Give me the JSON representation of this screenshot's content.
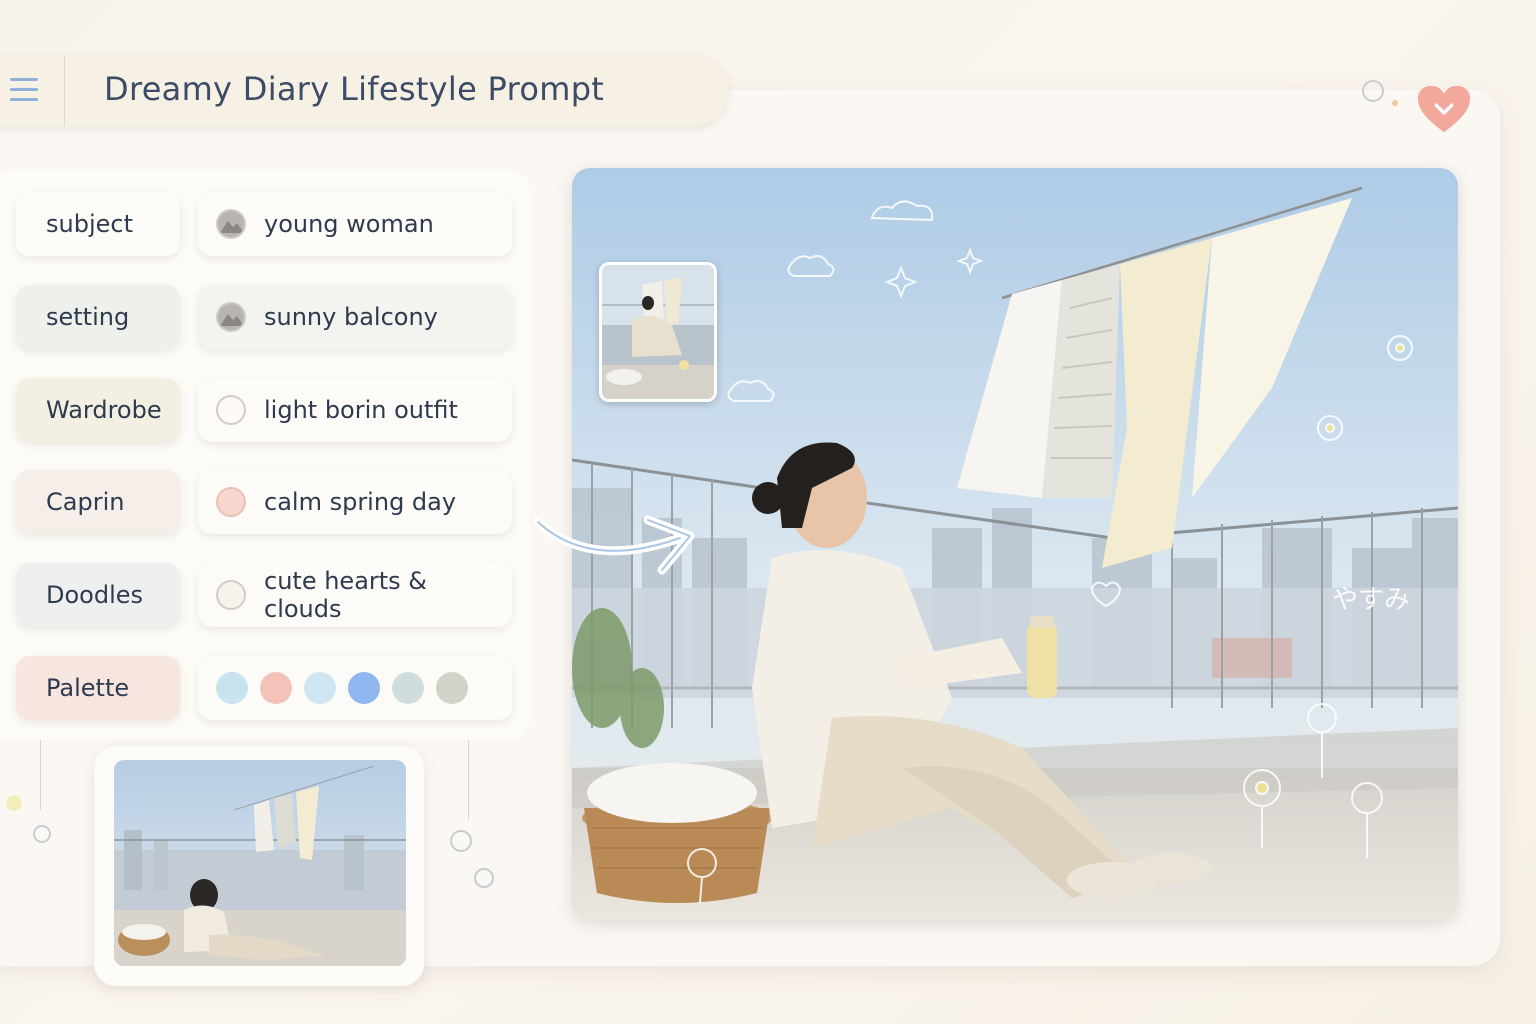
{
  "app": {
    "title": "Dreamy Diary Lifestyle Prompt"
  },
  "prompt_fields": [
    {
      "label": "subject",
      "value": "young woman",
      "label_color": "#fdfbf8",
      "dot_fill": "#b8b4b0",
      "dot_icon": "mountain-icon"
    },
    {
      "label": "setting",
      "value": "sunny balcony",
      "label_color": "#eef0ec",
      "dot_fill": "#b8b4b0",
      "dot_icon": "mountain-icon"
    },
    {
      "label": "Wardrobe",
      "value": "light borin outfit",
      "label_color": "#f3f0e3",
      "dot_fill": "#fdfaf5",
      "dot_icon": "circle-icon"
    },
    {
      "label": "Caprin",
      "value": "calm spring day",
      "label_color": "#f6efe9",
      "dot_fill": "#f6d6cd",
      "dot_icon": "circle-icon"
    },
    {
      "label": "Doodles",
      "value": "cute hearts & clouds",
      "label_color": "#edf0ee",
      "dot_fill": "#f6f2ec",
      "dot_icon": "circle-icon"
    },
    {
      "label": "Palette",
      "value": "",
      "label_color": "#f7e6df",
      "dot_fill": "",
      "dot_icon": "palette-icon"
    }
  ],
  "palette_swatches": [
    "#c7e4ef",
    "#f3c3b9",
    "#cfe6f2",
    "#8fb6ee",
    "#cfdcdc",
    "#d3d2c8"
  ],
  "scene": {
    "handwritten_caption": "やすみ",
    "icons": [
      "heart-icon",
      "menu-icon",
      "curved-arrow-icon",
      "flower-doodle-icon",
      "cloud-doodle-icon",
      "sparkle-doodle-icon"
    ]
  },
  "colors": {
    "accent_heart": "#f2a99c",
    "title_text": "#3c4b66",
    "menu_icon": "#8fb0d8"
  }
}
